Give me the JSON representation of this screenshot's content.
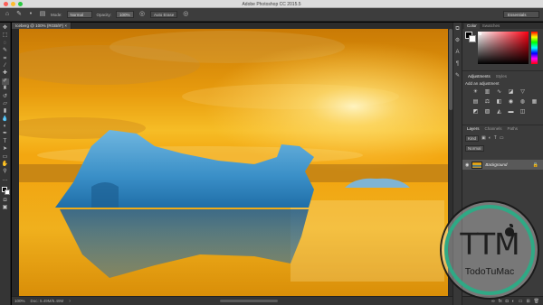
{
  "window": {
    "title": "Adobe Photoshop CC 2015.5"
  },
  "options_bar": {
    "mode_label": "Mode:",
    "mode_value": "Normal",
    "opacity_label": "Opacity:",
    "opacity_value": "100%",
    "auto_erase_label": "Auto Erase",
    "workspace_value": "Essentials"
  },
  "document": {
    "tab_label": "Iceberg @ 100% (RGB/8*)",
    "tab_close": "×"
  },
  "status_bar": {
    "zoom": "100%",
    "doc_info": "Doc: 5.49M/5.49M"
  },
  "panels": {
    "color_tabs": [
      "Color",
      "Swatches"
    ],
    "adjust_tabs": [
      "Adjustments",
      "Styles"
    ],
    "adjust_hint": "Add an adjustment",
    "layers_tabs": [
      "Layers",
      "Channels",
      "Paths"
    ],
    "layers_kind": "Kind",
    "blend_mode": "Normal",
    "layer": {
      "name": "Background"
    }
  },
  "watermark": {
    "monogram": "TTM",
    "name": "TodoTuMac",
    "ring_color": "#2fa985"
  },
  "colors": {
    "ui_dark": "#3b3b3b",
    "sky_gold": "#f0a812",
    "iceberg_blue": "#2f80b8"
  }
}
